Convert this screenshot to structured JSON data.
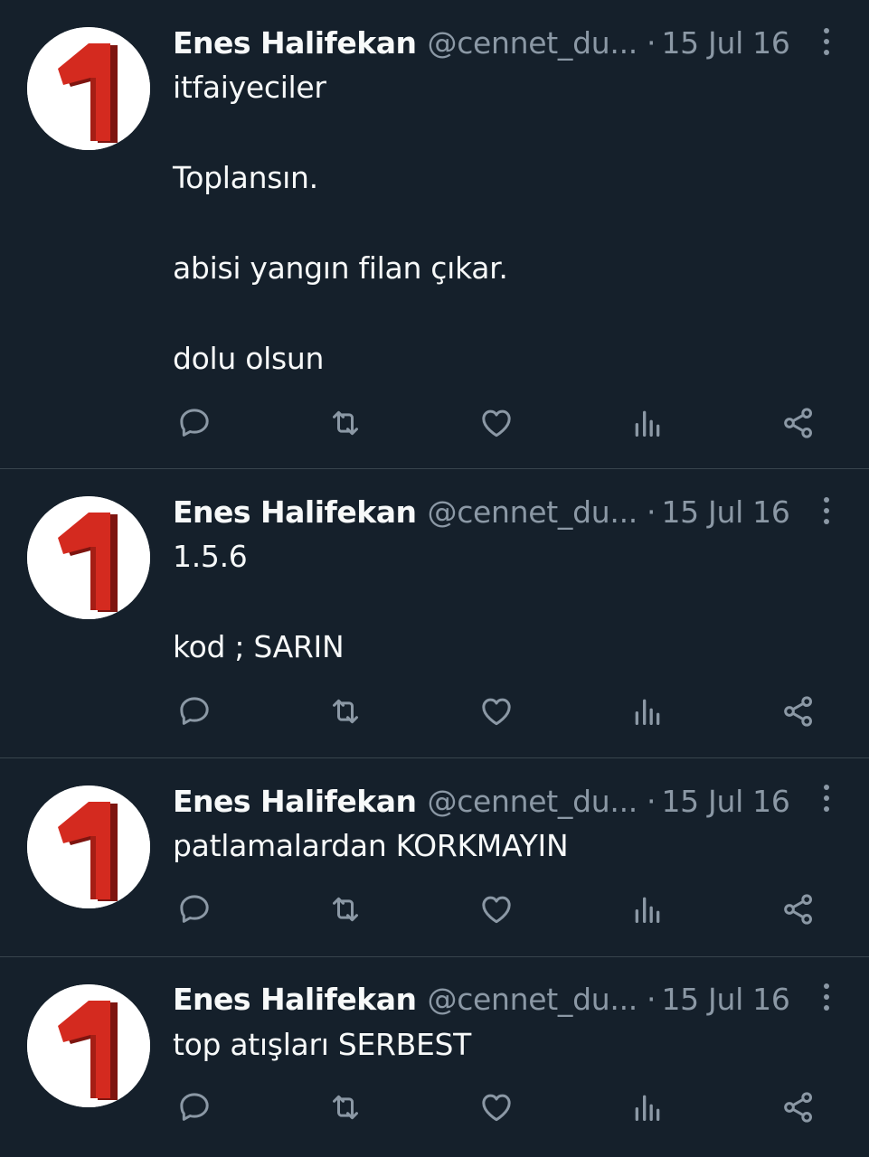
{
  "tweets": [
    {
      "name": "Enes Halifekan",
      "handle": "@cennet_du...",
      "separator": "·",
      "date": "15 Jul 16",
      "lines": [
        "itfaiyeciler",
        "",
        "Toplansın.",
        "",
        "abisi yangın filan çıkar.",
        "",
        "dolu olsun"
      ]
    },
    {
      "name": "Enes Halifekan",
      "handle": "@cennet_du...",
      "separator": "·",
      "date": "15 Jul 16",
      "lines": [
        "1.5.6",
        "",
        "kod ; SARIN"
      ]
    },
    {
      "name": "Enes Halifekan",
      "handle": "@cennet_du...",
      "separator": "·",
      "date": "15 Jul 16",
      "lines": [
        "patlamalardan KORKMAYIN"
      ]
    },
    {
      "name": "Enes Halifekan",
      "handle": "@cennet_du...",
      "separator": "·",
      "date": "15 Jul 16",
      "lines": [
        "top atışları SERBEST"
      ]
    }
  ],
  "avatar": {
    "glyph": "1",
    "colors": {
      "background": "#ffffff",
      "number": "#d42a1f",
      "number_shadow": "#7e1510"
    }
  },
  "actions": [
    {
      "icon": "reply-icon"
    },
    {
      "icon": "retweet-icon"
    },
    {
      "icon": "like-icon"
    },
    {
      "icon": "views-icon"
    },
    {
      "icon": "share-icon"
    }
  ],
  "colors": {
    "background": "#15202b",
    "text": "#f7f9f9",
    "muted": "#8b98a5",
    "divider": "#38444d"
  }
}
